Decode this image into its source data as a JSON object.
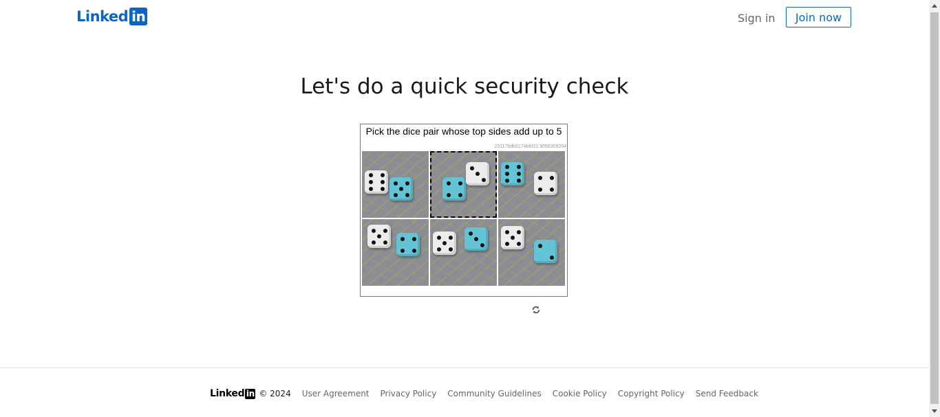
{
  "header": {
    "logo_text": "Linked",
    "logo_in": "in",
    "sign_in": "Sign in",
    "join_now": "Join now"
  },
  "main": {
    "title": "Let's do a quick security check"
  },
  "captcha": {
    "instruction": "Pick the dice pair whose top sides add up to 5",
    "challenge_id": "23117bdb5174b6f21.9056309204",
    "selected_tile": 2,
    "tiles": [
      {
        "index": 1,
        "dice": [
          {
            "color": "white",
            "pips": 6
          },
          {
            "color": "blue",
            "pips": 5
          }
        ]
      },
      {
        "index": 2,
        "dice": [
          {
            "color": "blue",
            "pips": 4
          },
          {
            "color": "white",
            "pips": 3
          }
        ]
      },
      {
        "index": 3,
        "dice": [
          {
            "color": "blue",
            "pips": 6
          },
          {
            "color": "white",
            "pips": 4
          }
        ]
      },
      {
        "index": 4,
        "dice": [
          {
            "color": "white",
            "pips": 5
          },
          {
            "color": "blue",
            "pips": 4
          }
        ]
      },
      {
        "index": 5,
        "dice": [
          {
            "color": "white",
            "pips": 5
          },
          {
            "color": "blue",
            "pips": 3
          }
        ]
      },
      {
        "index": 6,
        "dice": [
          {
            "color": "white",
            "pips": 5
          },
          {
            "color": "blue",
            "pips": 2
          }
        ]
      }
    ],
    "refresh_icon": "refresh-icon"
  },
  "footer": {
    "logo_text": "Linked",
    "logo_in": "in",
    "copyright": "© 2024",
    "links": [
      "User Agreement",
      "Privacy Policy",
      "Community Guidelines",
      "Cookie Policy",
      "Copyright Policy",
      "Send Feedback"
    ]
  },
  "colors": {
    "brand": "#0a66c2",
    "text": "#191919",
    "muted": "#666666"
  }
}
